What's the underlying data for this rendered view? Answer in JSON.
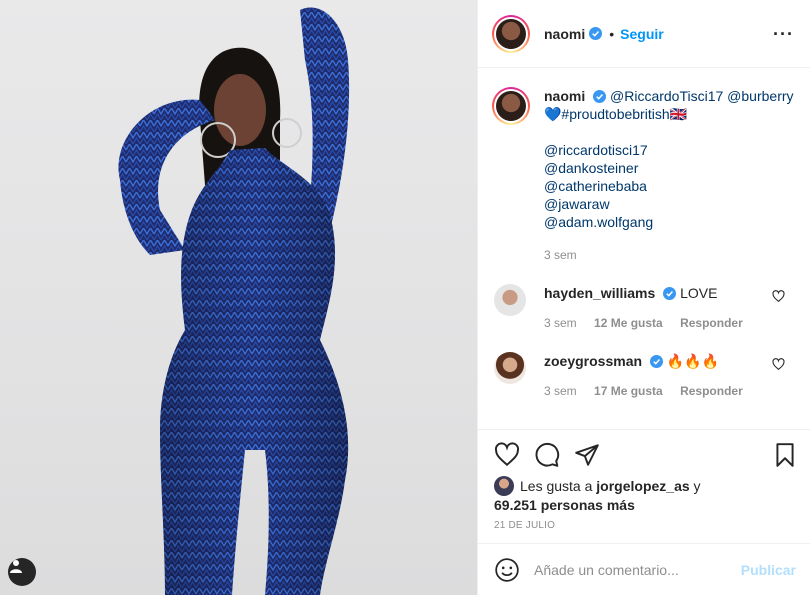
{
  "post": {
    "photo": {
      "alt": "",
      "tag_icon": "user-tag-icon"
    },
    "header": {
      "username": "naomi",
      "separator": "•",
      "follow_label": "Seguir",
      "more_icon": "more-options-icon"
    },
    "caption": {
      "username": "naomi",
      "line1_mentions": "@RiccardoTisci17 @burberry",
      "line2": "💙#proudtobebritish🇬🇧",
      "credits": [
        "@riccardotisci17",
        "@dankosteiner",
        "@catherinebaba",
        "@jawaraw",
        "@adam.wolfgang"
      ],
      "time": "3 sem"
    },
    "comments": [
      {
        "username": "hayden_williams",
        "text": "LOVE",
        "time": "3 sem",
        "likes": "12 Me gusta",
        "reply": "Responder"
      },
      {
        "username": "zoeygrossman",
        "text": "🔥🔥🔥",
        "time": "3 sem",
        "likes": "17 Me gusta",
        "reply": "Responder"
      }
    ],
    "likes": {
      "prefix": "Les gusta a",
      "first_user": "jorgelopez_as",
      "connector": "y",
      "others": "69.251 personas más"
    },
    "date": "21 DE JULIO",
    "add_comment": {
      "placeholder": "Añade un comentario...",
      "post_label": "Publicar"
    },
    "colors": {
      "accent": "#0095f6",
      "verified": "#3897f0",
      "muted": "#8e8e8e",
      "border": "#efefef",
      "publish_disabled": "#b2dffc"
    }
  }
}
